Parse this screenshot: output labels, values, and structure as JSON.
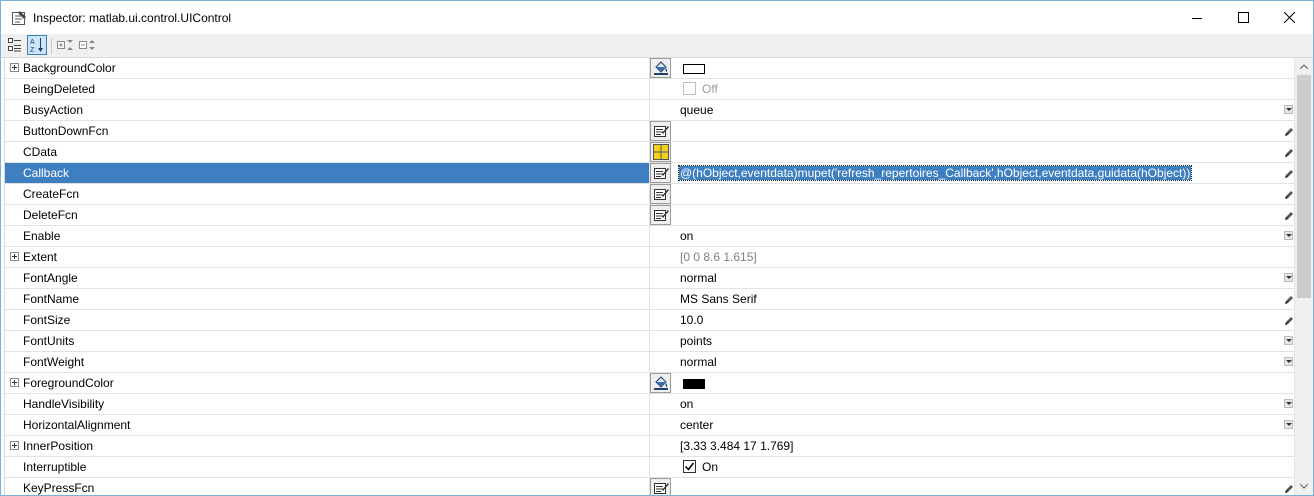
{
  "window": {
    "title": "Inspector:  matlab.ui.control.UIControl",
    "buttons": {
      "minimize": "minimize",
      "maximize": "maximize",
      "close": "close"
    }
  },
  "toolbar": {
    "buttons": [
      {
        "name": "categorize-button",
        "icon": "categorized-list-icon",
        "active": false
      },
      {
        "name": "sort-alphabetically-button",
        "icon": "sort-az-icon",
        "active": true
      },
      {
        "name": "expand-all-button",
        "icon": "expand-all-icon",
        "active": false
      },
      {
        "name": "collapse-all-button",
        "icon": "collapse-all-icon",
        "active": false
      }
    ]
  },
  "colors": {
    "selection": "#3e7fc1",
    "accent_border": "#7bb1d9",
    "readonly_text": "#808080"
  },
  "properties": [
    {
      "name": "BackgroundColor",
      "expandable": true,
      "editor": "color-picker",
      "value_type": "swatch",
      "swatch_color": "#ffffff",
      "value": ""
    },
    {
      "name": "BeingDeleted",
      "expandable": false,
      "editor": "",
      "value_type": "checkbox",
      "checked": false,
      "disabled": true,
      "value": "Off"
    },
    {
      "name": "BusyAction",
      "expandable": false,
      "editor": "",
      "value_type": "dropdown",
      "value": "queue"
    },
    {
      "name": "ButtonDownFcn",
      "expandable": false,
      "editor": "callback",
      "value_type": "pencil",
      "value": ""
    },
    {
      "name": "CData",
      "expandable": false,
      "editor": "grid",
      "value_type": "pencil",
      "value": ""
    },
    {
      "name": "Callback",
      "expandable": false,
      "editor": "callback",
      "value_type": "pencil",
      "selected": true,
      "value": "@(hObject,eventdata)mupet('refresh_repertoires_Callback',hObject,eventdata,guidata(hObject))"
    },
    {
      "name": "CreateFcn",
      "expandable": false,
      "editor": "callback",
      "value_type": "pencil",
      "value": ""
    },
    {
      "name": "DeleteFcn",
      "expandable": false,
      "editor": "callback",
      "value_type": "pencil",
      "value": ""
    },
    {
      "name": "Enable",
      "expandable": false,
      "editor": "",
      "value_type": "dropdown",
      "value": "on"
    },
    {
      "name": "Extent",
      "expandable": true,
      "editor": "",
      "value_type": "readonly",
      "value": "[0 0 8.6 1.615]"
    },
    {
      "name": "FontAngle",
      "expandable": false,
      "editor": "",
      "value_type": "dropdown",
      "value": "normal"
    },
    {
      "name": "FontName",
      "expandable": false,
      "editor": "",
      "value_type": "pencil",
      "value": "MS Sans Serif"
    },
    {
      "name": "FontSize",
      "expandable": false,
      "editor": "",
      "value_type": "pencil",
      "value": "10.0"
    },
    {
      "name": "FontUnits",
      "expandable": false,
      "editor": "",
      "value_type": "dropdown",
      "value": "points"
    },
    {
      "name": "FontWeight",
      "expandable": false,
      "editor": "",
      "value_type": "dropdown",
      "value": "normal"
    },
    {
      "name": "ForegroundColor",
      "expandable": true,
      "editor": "color-picker",
      "value_type": "swatch",
      "swatch_color": "#000000",
      "value": ""
    },
    {
      "name": "HandleVisibility",
      "expandable": false,
      "editor": "",
      "value_type": "dropdown",
      "value": "on"
    },
    {
      "name": "HorizontalAlignment",
      "expandable": false,
      "editor": "",
      "value_type": "dropdown",
      "value": "center"
    },
    {
      "name": "InnerPosition",
      "expandable": true,
      "editor": "",
      "value_type": "plain",
      "value": "[3.33 3.484 17 1.769]"
    },
    {
      "name": "Interruptible",
      "expandable": false,
      "editor": "",
      "value_type": "checkbox",
      "checked": true,
      "disabled": false,
      "value": "On"
    },
    {
      "name": "KeyPressFcn",
      "expandable": false,
      "editor": "callback",
      "value_type": "pencil",
      "value": ""
    }
  ]
}
